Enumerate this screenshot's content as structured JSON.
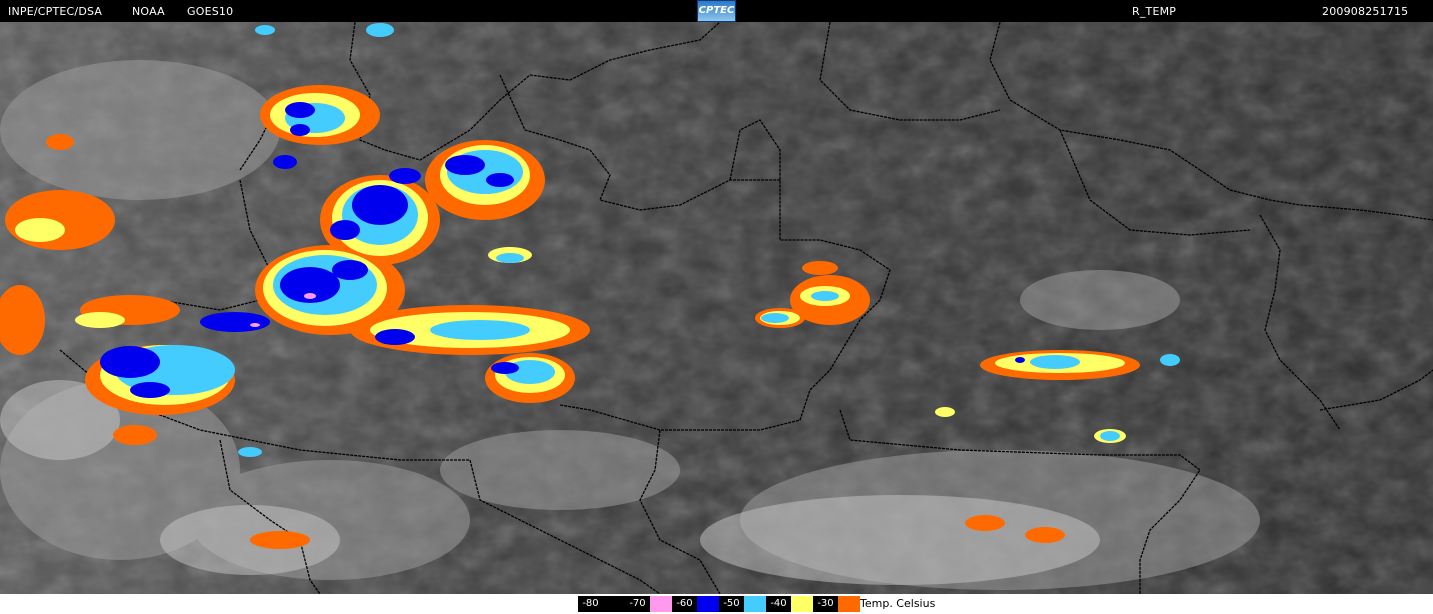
{
  "header": {
    "institution": "INPE/CPTEC/DSA",
    "agency": "NOAA",
    "satellite": "GOES10",
    "logo_text": "CPTEC",
    "product": "R_TEMP",
    "datetime": "200908251715"
  },
  "legend": {
    "unit_label": "Temp. Celsius",
    "items": [
      {
        "label": "-80",
        "color": "#000000"
      },
      {
        "label": "-70",
        "color": "#ff99ee"
      },
      {
        "label": "-60",
        "color": "#0000ee"
      },
      {
        "label": "-50",
        "color": "#44ccff"
      },
      {
        "label": "-40",
        "color": "#ffff66"
      },
      {
        "label": "-30",
        "color": "#ff6a00"
      }
    ]
  },
  "colors": {
    "background": "#000000",
    "cloud_free": "#3a3a3a",
    "border_lines": "#000000"
  }
}
